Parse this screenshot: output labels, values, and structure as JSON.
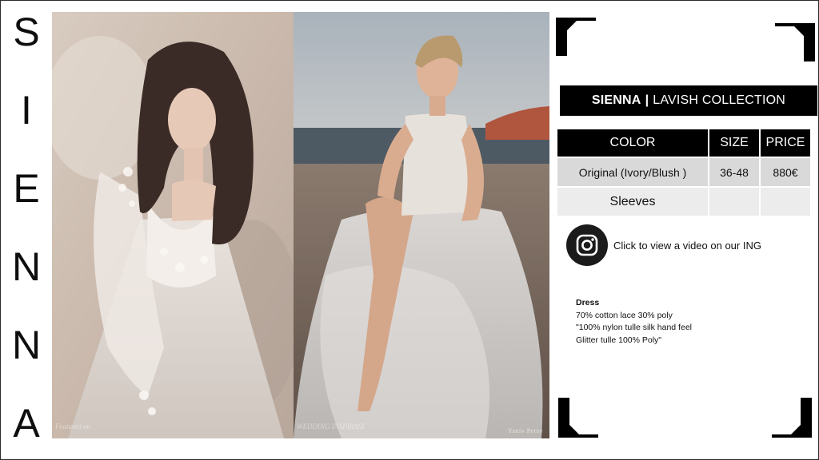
{
  "brand_vertical": [
    "S",
    "I",
    "E",
    "N",
    "N",
    "A"
  ],
  "photos": {
    "left": {
      "watermark": "Featured on"
    },
    "right": {
      "watermark": "WEDDING INSPIRASI",
      "credit": "Yaniv Persy"
    }
  },
  "title": {
    "name": "SIENNA",
    "separator": "|",
    "collection": "LAVISH COLLECTION"
  },
  "table": {
    "headers": [
      "COLOR",
      "SIZE",
      "PRICE"
    ],
    "rows": [
      [
        "Original (Ivory/Blush )",
        "36-48",
        "880€"
      ],
      [
        "Sleeves",
        "",
        ""
      ]
    ]
  },
  "instagram": {
    "icon": "instagram-icon",
    "text": "Click to view a video on our ING"
  },
  "fabric": {
    "heading": "Dress",
    "lines": [
      "70% cotton lace 30% poly",
      "\"100% nylon tulle silk hand feel",
      "Glitter tulle 100% Poly\""
    ]
  },
  "colors": {
    "black": "#000000",
    "row_dark": "#d9d9d9",
    "row_light": "#ececec"
  }
}
